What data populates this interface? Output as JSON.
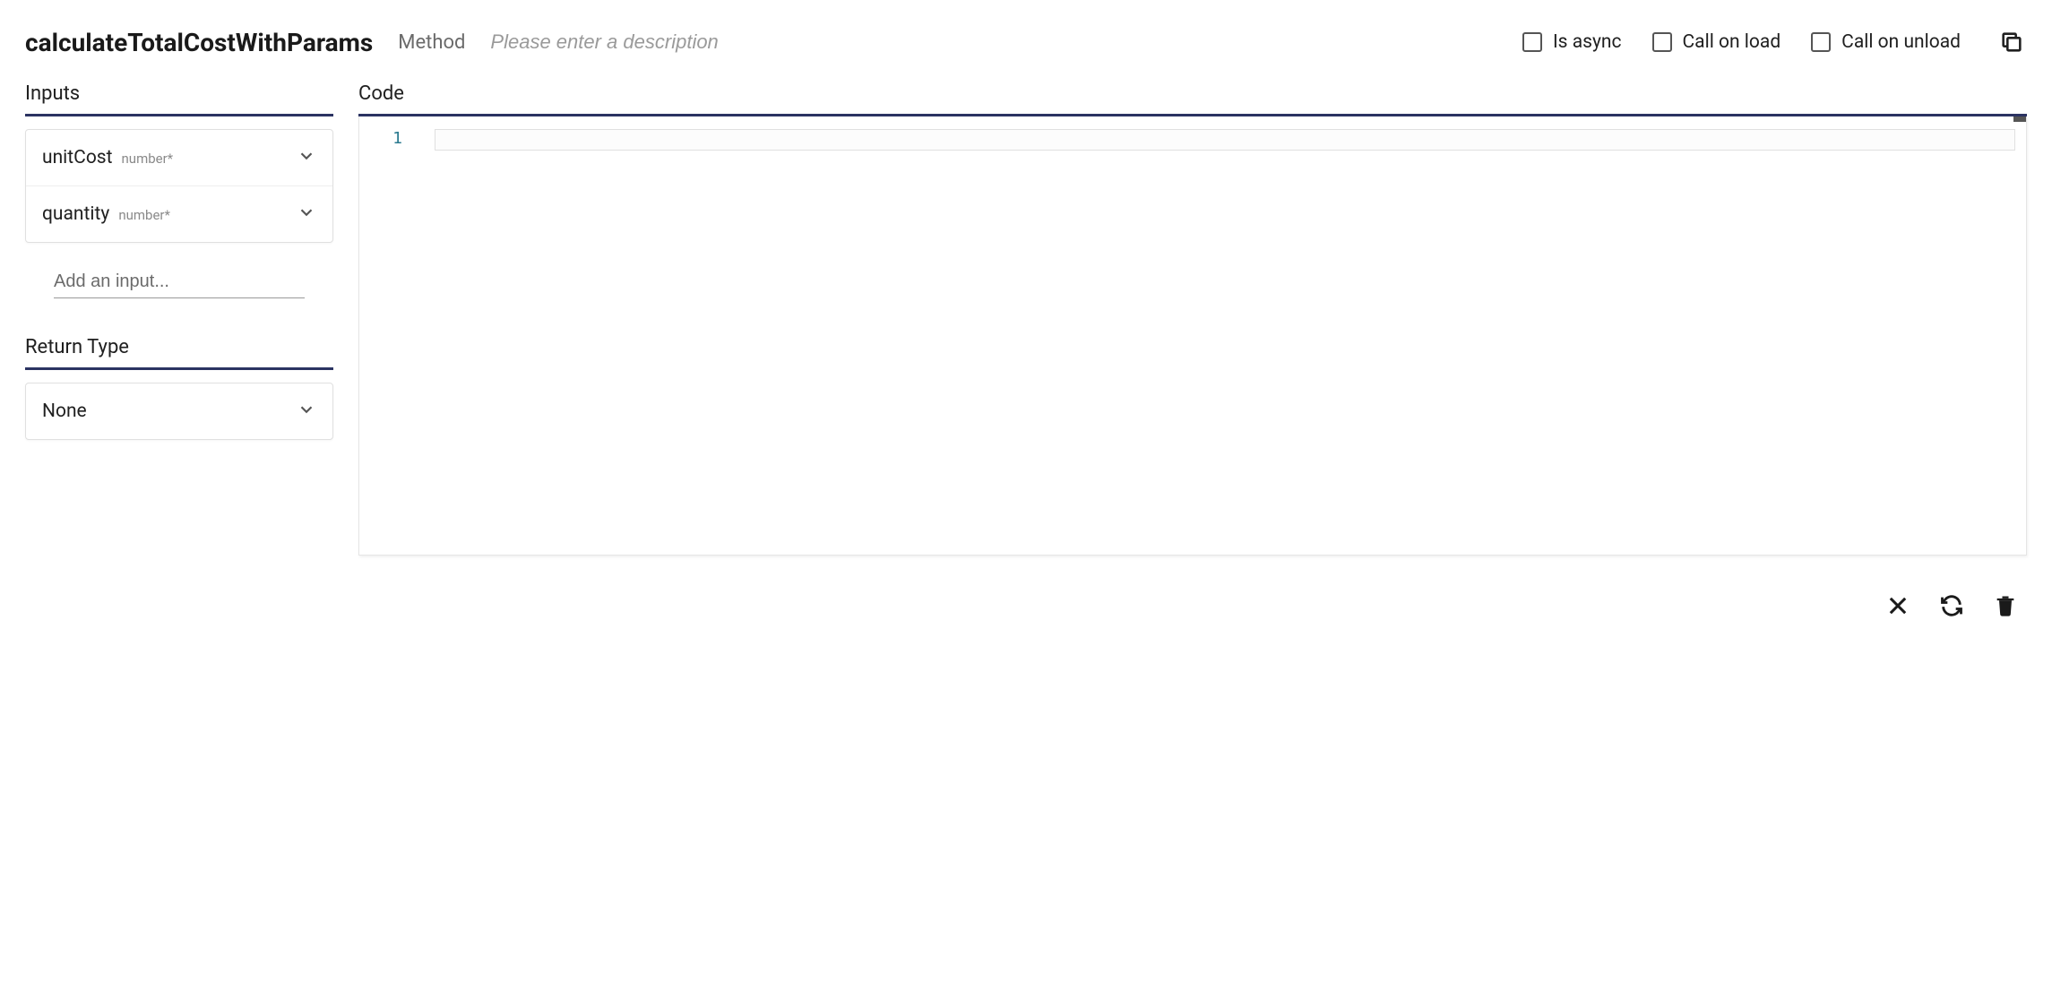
{
  "header": {
    "name": "calculateTotalCostWithParams",
    "kind": "Method",
    "description_placeholder": "Please enter a description",
    "checkboxes": {
      "is_async": "Is async",
      "call_on_load": "Call on load",
      "call_on_unload": "Call on unload"
    }
  },
  "sections": {
    "inputs_title": "Inputs",
    "code_title": "Code",
    "return_title": "Return Type",
    "add_input_placeholder": "Add an input..."
  },
  "inputs": [
    {
      "name": "unitCost",
      "type": "number*"
    },
    {
      "name": "quantity",
      "type": "number*"
    }
  ],
  "return_type": "None",
  "code": {
    "line_number_start": "1"
  }
}
